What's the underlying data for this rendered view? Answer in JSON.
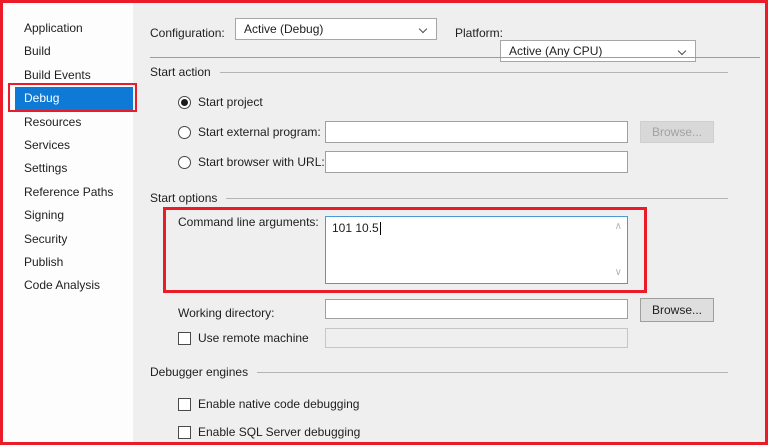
{
  "colors": {
    "annotation_red": "#ea1c27",
    "selection_blue": "#0e7ad6",
    "focus_border_blue": "#4a9bd5",
    "panel_gray": "#f0efef"
  },
  "sidebar": {
    "items": [
      {
        "label": "Application",
        "selected": false
      },
      {
        "label": "Build",
        "selected": false
      },
      {
        "label": "Build Events",
        "selected": false
      },
      {
        "label": "Debug",
        "selected": true
      },
      {
        "label": "Resources",
        "selected": false
      },
      {
        "label": "Services",
        "selected": false
      },
      {
        "label": "Settings",
        "selected": false
      },
      {
        "label": "Reference Paths",
        "selected": false
      },
      {
        "label": "Signing",
        "selected": false
      },
      {
        "label": "Security",
        "selected": false
      },
      {
        "label": "Publish",
        "selected": false
      },
      {
        "label": "Code Analysis",
        "selected": false
      }
    ]
  },
  "toolbar": {
    "configuration_label": "Configuration:",
    "configuration_value": "Active (Debug)",
    "platform_label": "Platform:",
    "platform_value": "Active (Any CPU)"
  },
  "sections": {
    "start_action": {
      "title": "Start action",
      "start_project": {
        "label": "Start project",
        "selected": true
      },
      "start_external": {
        "label": "Start external program:",
        "value": "",
        "browse_label": "Browse...",
        "browse_enabled": false
      },
      "start_browser": {
        "label": "Start browser with URL:",
        "value": ""
      }
    },
    "start_options": {
      "title": "Start options",
      "command_line": {
        "label": "Command line arguments:",
        "value": "101 10.5"
      },
      "working_directory": {
        "label": "Working directory:",
        "value": "",
        "browse_label": "Browse...",
        "browse_enabled": true
      },
      "remote_machine": {
        "label": "Use remote machine",
        "checked": false,
        "value": ""
      }
    },
    "debugger_engines": {
      "title": "Debugger engines",
      "native_debugging": {
        "label": "Enable native code debugging",
        "checked": false
      },
      "sql_debugging": {
        "label": "Enable SQL Server debugging",
        "checked": false
      }
    }
  },
  "icons": {
    "scroll_up": "∧",
    "scroll_down": "∨"
  }
}
